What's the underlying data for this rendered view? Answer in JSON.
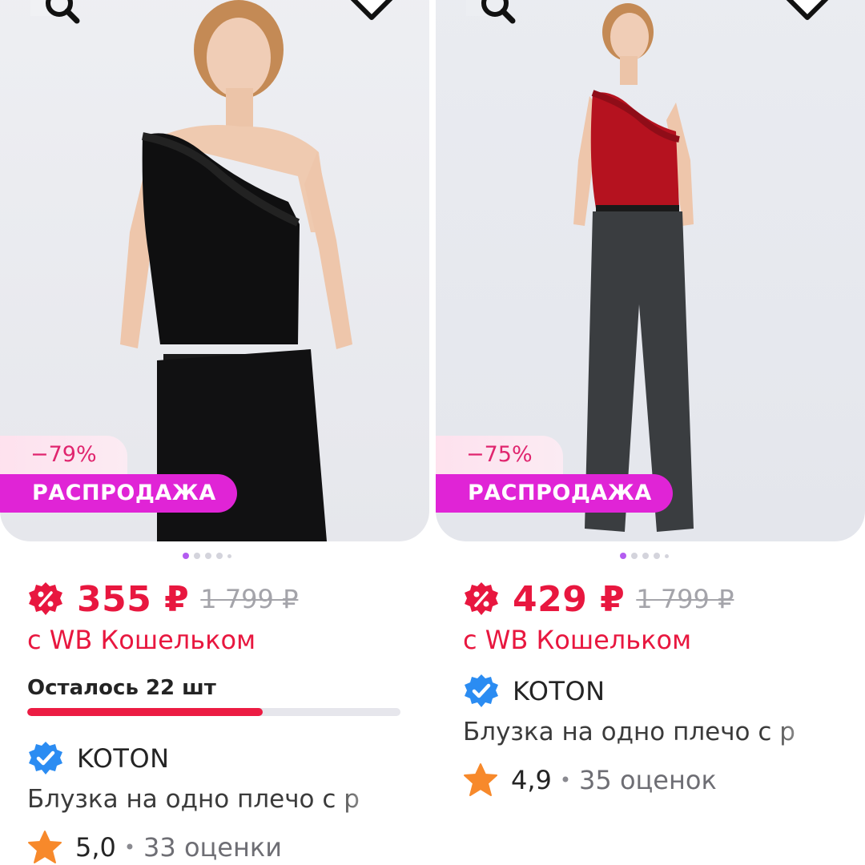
{
  "products": [
    {
      "discount": "−79%",
      "sale_label": "РАСПРОДАЖА",
      "price": "355 ₽",
      "old_price": "1 799 ₽",
      "wallet_note": "с WB Кошельком",
      "stock_text": "Осталось 22 шт",
      "stock_fraction": 0.63,
      "brand": "KOTON",
      "title": "Блузка на одно плечо с р",
      "rating": "5,0",
      "separator": "•",
      "reviews": "33 оценки",
      "top_color": "#0f0f10",
      "pants_color": "#111112"
    },
    {
      "discount": "−75%",
      "sale_label": "РАСПРОДАЖА",
      "price": "429 ₽",
      "old_price": "1 799 ₽",
      "wallet_note": "с WB Кошельком",
      "brand": "KOTON",
      "title": "Блузка на одно плечо с р",
      "rating": "4,9",
      "separator": "•",
      "reviews": "35 оценок",
      "top_color": "#b5121f",
      "pants_color": "#3a3d40"
    }
  ],
  "icons": [
    "search-image-icon",
    "heart-icon",
    "discount-badge-icon",
    "verified-icon",
    "star-icon"
  ],
  "colors": {
    "accent": "#e8173f",
    "sale": "#e024d6",
    "discount_text": "#e0256e",
    "dot_active": "#b35cf0",
    "verified": "#2b8cf2",
    "star": "#f7892b"
  }
}
